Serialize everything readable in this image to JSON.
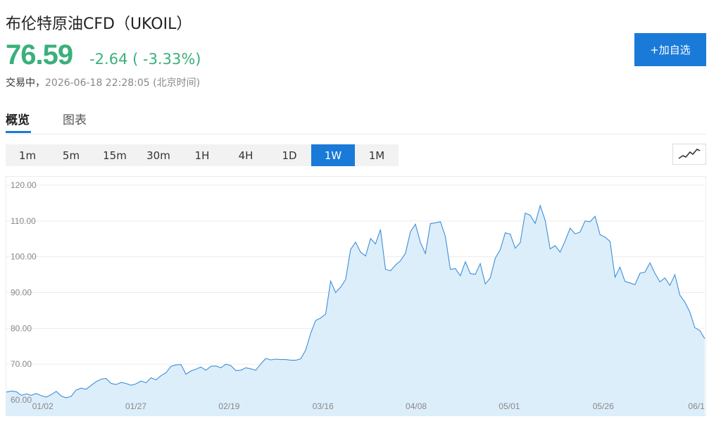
{
  "header": {
    "title": "布伦特原油CFD（UKOIL）",
    "price": "76.59",
    "change": "-2.64 ( -3.33%)",
    "status_state": "交易中，",
    "status_time": "2026-06-18 22:28:05 (北京时间)",
    "add_button": "+加自选"
  },
  "colors": {
    "up_down": "#3ab07a",
    "accent": "#1a7ad8",
    "area_fill": "#ddeefb",
    "line": "#3d8fd9"
  },
  "tabs": [
    {
      "label": "概览",
      "active": true
    },
    {
      "label": "图表",
      "active": false
    }
  ],
  "periods": [
    {
      "label": "1m",
      "active": false
    },
    {
      "label": "5m",
      "active": false
    },
    {
      "label": "15m",
      "active": false
    },
    {
      "label": "30m",
      "active": false
    },
    {
      "label": "1H",
      "active": false
    },
    {
      "label": "4H",
      "active": false
    },
    {
      "label": "1D",
      "active": false
    },
    {
      "label": "1W",
      "active": true
    },
    {
      "label": "1M",
      "active": false
    }
  ],
  "chart_type_icon": "line-chart-icon",
  "chart_data": {
    "type": "area",
    "ylim": [
      60,
      120
    ],
    "yticks": [
      "60.00",
      "70.00",
      "80.00",
      "90.00",
      "100.00",
      "110.00",
      "120.00"
    ],
    "xticks": [
      "01/02",
      "01/27",
      "02/19",
      "03/16",
      "04/08",
      "05/01",
      "05/26",
      "06/1"
    ],
    "xtick_positions": [
      5.2,
      18.5,
      31.8,
      45.2,
      58.5,
      71.8,
      85.2,
      98.5
    ],
    "grid": true,
    "series": [
      {
        "values": [
          62.2,
          62.5,
          62.3,
          61.3,
          61.7,
          61.3,
          61.8,
          61.2,
          60.8,
          61.5,
          62.4,
          61.1,
          60.6,
          61.0,
          62.8,
          63.3,
          63.0,
          64.1,
          65.1,
          65.8,
          66.0,
          64.6,
          64.3,
          64.9,
          64.6,
          64.1,
          64.5,
          65.3,
          64.8,
          66.2,
          65.6,
          66.8,
          67.6,
          69.4,
          69.8,
          69.9,
          67.2,
          68.1,
          68.6,
          69.2,
          68.3,
          69.4,
          69.5,
          69.0,
          70.0,
          69.6,
          68.2,
          68.3,
          69.0,
          68.7,
          68.3,
          70.1,
          71.6,
          71.2,
          71.4,
          71.3,
          71.3,
          71.1,
          71.1,
          71.5,
          73.9,
          78.6,
          82.2,
          82.9,
          84.0,
          93.2,
          90.0,
          91.5,
          93.6,
          102.0,
          104.1,
          101.3,
          100.2,
          105.1,
          103.6,
          107.6,
          96.5,
          96.1,
          97.7,
          98.9,
          101.0,
          107.0,
          109.1,
          104.0,
          100.9,
          109.3,
          109.5,
          109.8,
          105.7,
          96.5,
          96.7,
          94.7,
          98.6,
          95.3,
          95.1,
          98.1,
          92.4,
          94.1,
          99.6,
          102.0,
          106.7,
          106.3,
          102.4,
          103.9,
          112.2,
          111.6,
          109.3,
          114.3,
          110.2,
          102.2,
          103.1,
          101.3,
          104.4,
          108.0,
          106.4,
          106.9,
          110.0,
          109.8,
          111.3,
          106.2,
          105.5,
          104.3,
          94.3,
          97.1,
          93.1,
          92.7,
          92.2,
          95.4,
          95.7,
          98.3,
          95.4,
          93.0,
          94.1,
          92.0,
          95.0,
          89.3,
          87.3,
          84.6,
          80.2,
          79.4,
          77.1
        ]
      }
    ]
  }
}
